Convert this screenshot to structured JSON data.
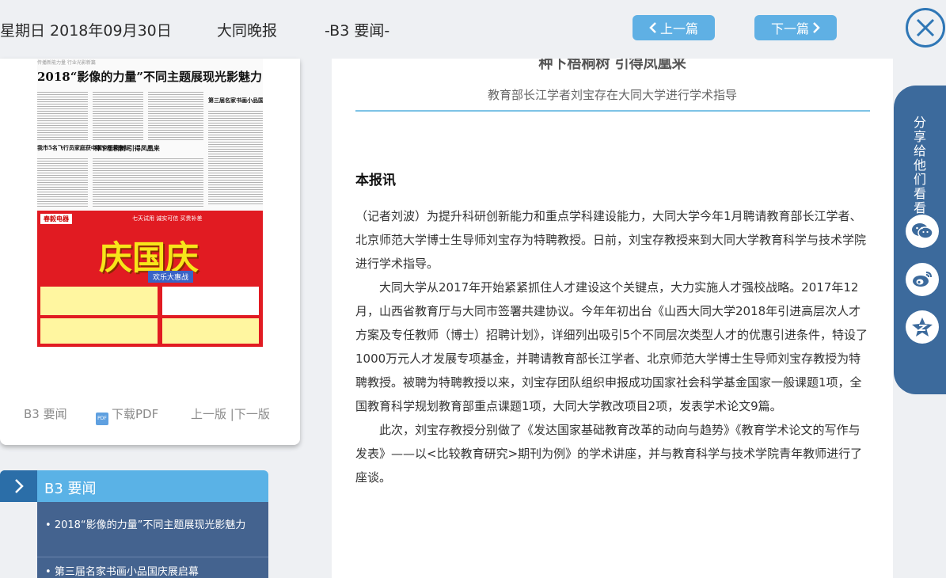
{
  "header": {
    "date": "星期日 2018年09月30日",
    "paper_name": "大同晚报",
    "page": "-B3 要闻-",
    "prev_label": "上一篇",
    "next_label": "下一篇"
  },
  "thumbnail": {
    "paper_top_strip": "传播新能力量 行业光影新篇",
    "headline": "2018“影像的力量”不同主题展现光影魅力",
    "sub_headlines": [
      "第三届名家书画小品国庆展启幕",
      "我市5名飞行员家庭获中国空军荣誉証",
      "种下梧桐树  引得凤凰来"
    ],
    "ad": {
      "brand": "春毅电器",
      "slogan": "七天试用  诚实可信  买贵补差",
      "big_text": "庆国庆",
      "banner": "欢乐大惠战"
    },
    "links": {
      "page": "B3 要闻",
      "download": "下载PDF",
      "pager": "上一版 |下一版"
    }
  },
  "section": {
    "label": "B3  要闻",
    "articles": [
      "2018“影像的力量”不同主题展现光影魅力",
      "第三届名家书画小品国庆展启幕"
    ]
  },
  "article": {
    "title": "种下梧桐树 引得凤凰来",
    "subtitle": "教育部长江学者刘宝存在大同大学进行学术指导",
    "lead": "本报讯",
    "paragraphs": [
      "（记者刘波）为提升科研创新能力和重点学科建设能力，大同大学今年1月聘请教育部长江学者、北京师范大学博士生导师刘宝存为特聘教授。日前，刘宝存教授来到大同大学教育科学与技术学院进行学术指导。",
      "大同大学从2017年开始紧紧抓住人才建设这个关键点，大力实施人才强校战略。2017年12月，山西省教育厅与大同市签署共建协议。今年年初出台《山西大同大学2018年引进高层次人才方案及专任教师（博士）招聘计划》，详细列出吸引5个不同层次类型人才的优惠引进条件，特设了1000万元人才发展专项基金，并聘请教育部长江学者、北京师范大学博士生导师刘宝存教授为特聘教授。被聘为特聘教授以来，刘宝存团队组织申报成功国家社会科学基金国家一般课题1项，全国教育科学规划教育部重点课题1项，大同大学教改项目2项，发表学术论文9篇。",
      "此次，刘宝存教授分别做了《发达国家基础教育改革的动向与趋势》《教育学术论文的写作与发表》——以<比较教育研究>期刊为例》的学术讲座，并与教育科学与技术学院青年教师进行了座谈。"
    ]
  },
  "share": {
    "label": "分享给他们看看",
    "buttons": [
      "wechat-icon",
      "weibo-icon",
      "qzone-icon"
    ]
  },
  "colors": {
    "accent": "#5fb0e4",
    "dark_blue": "#2f77b6",
    "share_panel": "#3c6a9c",
    "list_bg": "#44638f"
  }
}
